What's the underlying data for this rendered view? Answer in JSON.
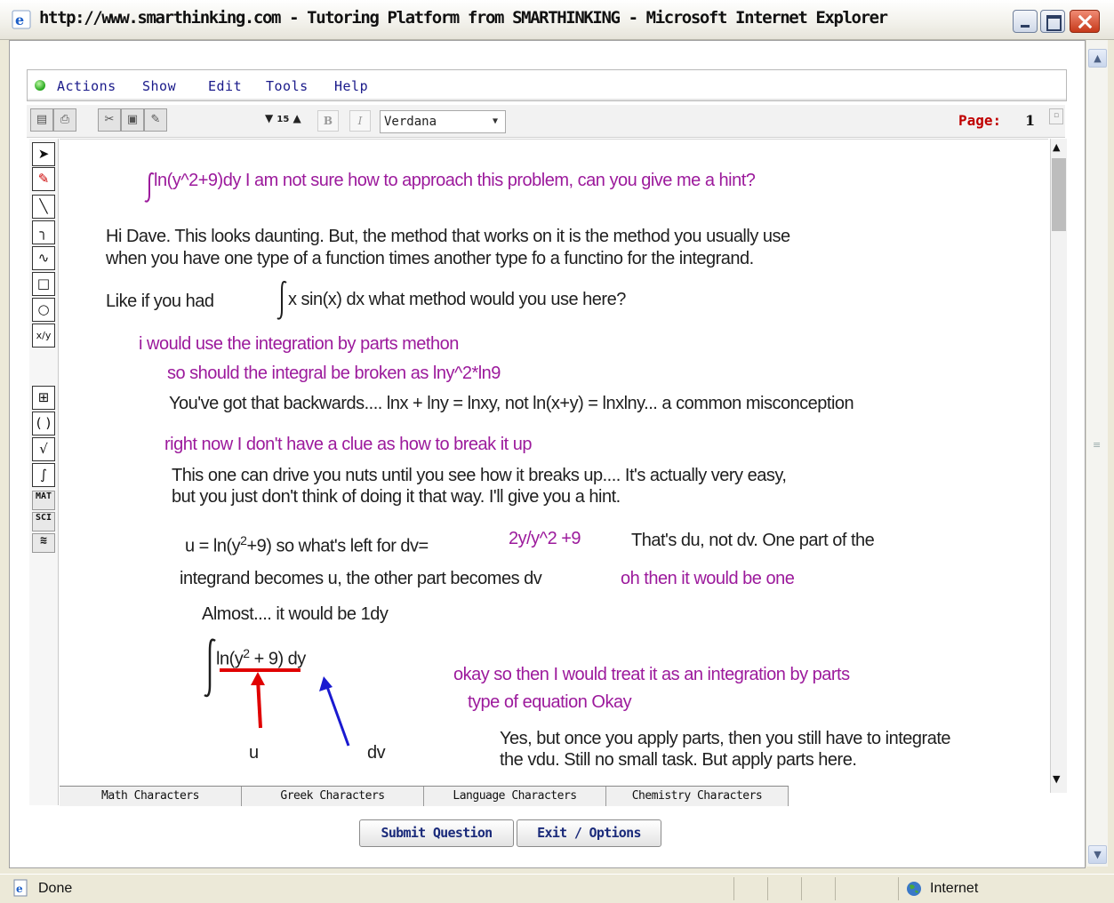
{
  "window": {
    "title": "http://www.smarthinking.com - Tutoring Platform from SMARTHINKING - Microsoft Internet Explorer"
  },
  "menu": {
    "items": [
      "Actions",
      "Show",
      "Edit",
      "Tools",
      "Help"
    ]
  },
  "toolbar": {
    "font_size": "15",
    "bold_label": "B",
    "italic_label": "I",
    "font_name": "Verdana",
    "page_label": "Page:",
    "page_number": "1"
  },
  "tools": {
    "mat_label": "MAT",
    "sci_label": "SCI"
  },
  "colors": {
    "student_text": "#9c1a9c",
    "tutor_text": "#1e1e1e",
    "page_label": "#c00000",
    "arrow_u": "#e00000",
    "arrow_dv": "#1a1ad0"
  },
  "whiteboard": {
    "line1": "ln(y^2+9)dy   I am not sure how to approach this problem, can you give me a hint?",
    "line2": "Hi Dave.  This looks daunting.  But, the method that works on it is the method you usually use",
    "line3": "when you have one type of a function  times another type fo a functino for the integrand.",
    "line4a": "Like if you had",
    "line4b": "x sin(x) dx   what method would you use here?",
    "line5": "i would use the integration by parts methon",
    "line6": "so should the integral be broken as lny^2*ln9",
    "line7": "You've got that backwards....  lnx + lny = lnxy, not ln(x+y) = lnxlny... a common misconception",
    "line8": "right now I don't have a clue as how to break it up",
    "line9": "This one can drive you nuts until you see how it breaks up....  It's actually very easy,",
    "line10": "but you just don't think of doing it that way.  I'll give you a hint.",
    "line11a": "u = ln(y",
    "line11sup": "2",
    "line11b": "+9)   so what's left for dv=",
    "line11c": "2y/y^2 +9",
    "line11d": "That's du, not dv.  One part of the",
    "line12a": "integrand becomes u, the other part becomes dv",
    "line12b": "oh then it  would be one",
    "line13": "Almost.... it would be 1dy",
    "formula_a": "ln(y",
    "formula_sup": "2",
    "formula_b": " + 9) dy",
    "label_u": "u",
    "label_dv": "dv",
    "line14": "okay so then I would treat it as an integration by parts",
    "line15": "type of equation Okay",
    "line16": "Yes, but once you apply parts, then you still have to integrate",
    "line17": "the vdu.  Still no small task.   But apply parts here."
  },
  "char_tabs": [
    "Math Characters",
    "Greek Characters",
    "Language Characters",
    "Chemistry Characters"
  ],
  "buttons": {
    "submit": "Submit Question",
    "exit": "Exit / Options"
  },
  "status": {
    "text": "Done",
    "zone": "Internet"
  }
}
